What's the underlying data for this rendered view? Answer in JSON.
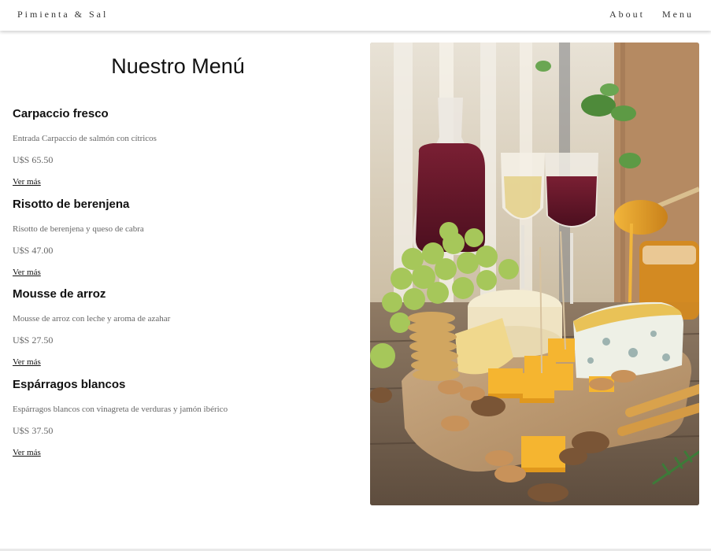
{
  "header": {
    "brand": "Pimienta & Sal",
    "nav": [
      {
        "label": "About"
      },
      {
        "label": "Menu"
      }
    ]
  },
  "menu": {
    "title": "Nuestro Menú",
    "items": [
      {
        "name": "Carpaccio fresco",
        "description": "Entrada Carpaccio de salmón con cítricos",
        "price": "U$S 65.50",
        "link": "Ver más"
      },
      {
        "name": "Risotto de berenjena",
        "description": "Risotto de berenjena y queso de cabra",
        "price": "U$S 47.00",
        "link": "Ver más"
      },
      {
        "name": "Mousse de arroz",
        "description": "Mousse de arroz con leche y aroma de azahar",
        "price": "U$S 27.50",
        "link": "Ver más"
      },
      {
        "name": "Espárragos blancos",
        "description": "Espárragos blancos con vinagreta de verduras y jamón ibérico",
        "price": "U$S 37.50",
        "link": "Ver más"
      }
    ]
  },
  "colors": {
    "text": "#111111",
    "muted": "#666666",
    "header_bg": "#ffffff"
  }
}
